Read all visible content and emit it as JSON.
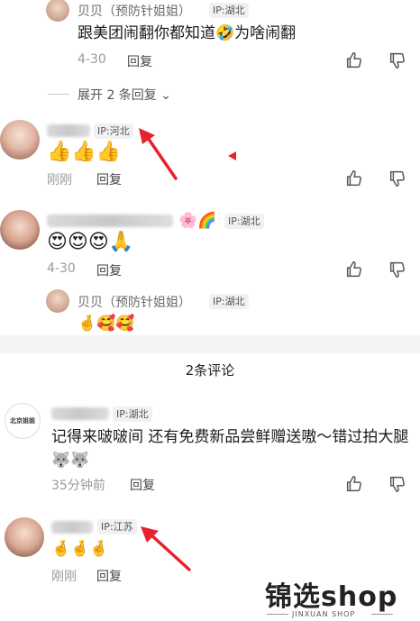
{
  "comments": [
    {
      "id": "reply-top",
      "author": "贝贝（预防针姐姐）",
      "ip": "IP:湖北",
      "text": "跟美团闹翻你都知道🤣为啥闹翻",
      "time": "4-30",
      "reply_label": "回复"
    },
    {
      "id": "c1",
      "author_blur": "",
      "ip": "IP:河北",
      "emojis": "👍👍👍",
      "time": "刚刚",
      "reply_label": "回复"
    },
    {
      "id": "c2",
      "ip": "IP:湖北",
      "name_decor": "🌸🌈",
      "emojis": "😍😍😍🙏",
      "time": "4-30",
      "reply_label": "回复"
    },
    {
      "id": "reply-bottom",
      "author": "贝贝（预防针姐姐）",
      "ip": "IP:湖北",
      "emojis": "🤞🥰🥰"
    },
    {
      "id": "c3",
      "ip": "IP:湖北",
      "avatar_label": "北京姐姐",
      "text": "记得来啵啵间 还有免费新品尝鲜赠送嗷～错过拍大腿🐺🐺",
      "time": "35分钟前",
      "reply_label": "回复"
    },
    {
      "id": "c4",
      "ip": "IP:江苏",
      "emojis": "🤞🤞🤞",
      "time": "刚刚",
      "reply_label": "回复"
    }
  ],
  "expand_label": "展开 2 条回复",
  "section_title": "2条评论",
  "watermark": {
    "brand": "锦选shop",
    "sub": "JINXUAN SHOP"
  },
  "colors": {
    "arrow": "#e8212e",
    "ip_bg": "#f1f1f1"
  }
}
